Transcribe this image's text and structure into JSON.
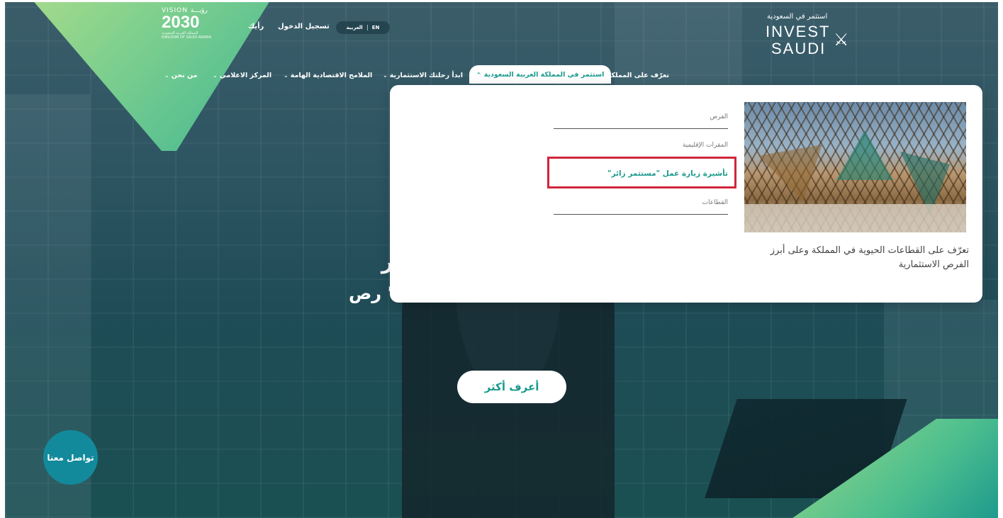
{
  "header": {
    "vision": {
      "top": "VISION رؤيـــة",
      "number": "2030",
      "subtitle_ar": "المملكة العربية السعودية",
      "subtitle_en": "KINGDOM OF SAUDI ARABIA"
    },
    "feedback_link": "رأيك",
    "login_link": "تسجيل الدخول",
    "lang_en": "EN",
    "lang_ar": "العربية",
    "brand": {
      "arabic": "استثمر في السعودية",
      "line1": "INVEST",
      "line2": "SAUDI"
    }
  },
  "nav": {
    "item1": "تعرّف على المملكة",
    "item2_active": "استثمر في المملكة العربية السعودية",
    "item3": "ابدأ رحلتك الاستثمارية",
    "item4": "الملامح الاقتصادية الهامة",
    "item5": "المركز الاعلامي",
    "item6": "من نحن"
  },
  "dropdown": {
    "items": [
      "الفرص",
      "المقرات الإقليمية",
      "تأشيرة زيارة عمل \"مستثمر زائر\"",
      "القطاعات"
    ],
    "description": "تعرّف على القطاعات الحيوية في المملكة وعلى أبرز الفرص الاستثمارية"
  },
  "hero": {
    "fragment_line1": "ر",
    "fragment_line2_left": "رص \"",
    "fragment_line2_mid": "\""
  },
  "cta_label": "أعرف أكثر",
  "contact_label": "تواصل معنا",
  "colors": {
    "accent": "#1a9a8e",
    "contact_bg": "#138a9c",
    "highlight": "#d0263a"
  }
}
